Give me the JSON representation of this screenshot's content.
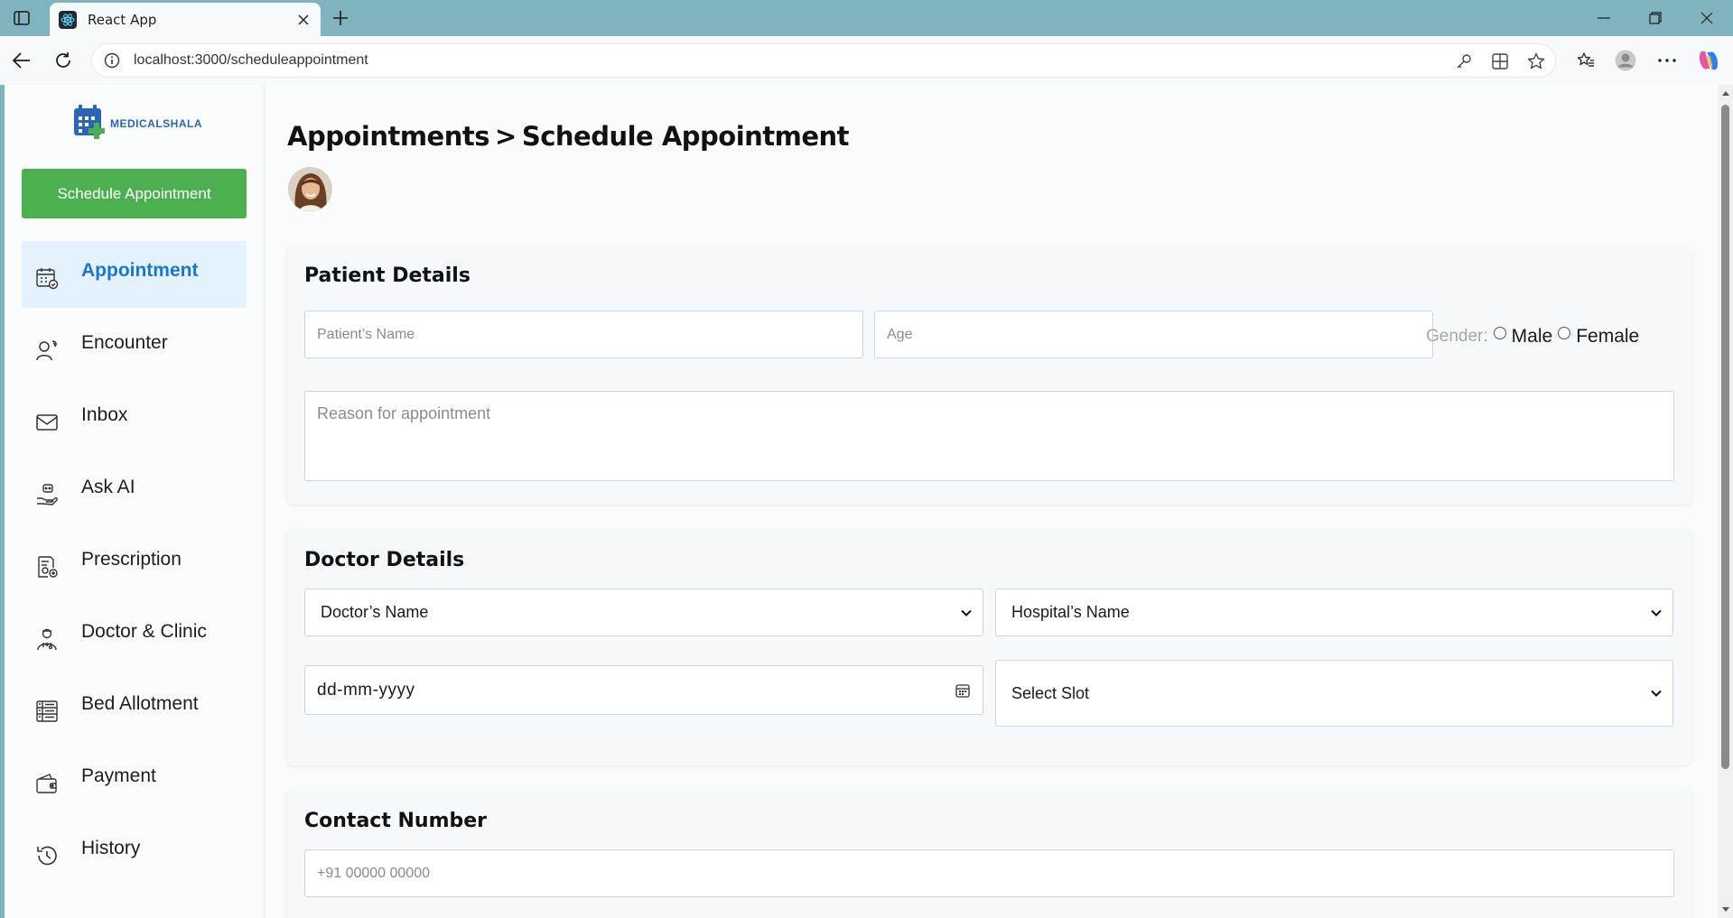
{
  "browser": {
    "tab_title": "React App",
    "url": "localhost:3000/scheduleappointment"
  },
  "sidebar": {
    "logo_text": "MEDICALSHALA",
    "schedule_button": "Schedule Appointment",
    "items": [
      {
        "label": "Appointment",
        "icon": "calendar-icon",
        "active": true
      },
      {
        "label": "Encounter",
        "icon": "user-chat-icon",
        "active": false
      },
      {
        "label": "Inbox",
        "icon": "mail-icon",
        "active": false
      },
      {
        "label": "Ask AI",
        "icon": "hand-ai-icon",
        "active": false
      },
      {
        "label": "Prescription",
        "icon": "prescription-icon",
        "active": false
      },
      {
        "label": "Doctor & Clinic",
        "icon": "doctor-icon",
        "active": false
      },
      {
        "label": "Bed Allotment",
        "icon": "bed-list-icon",
        "active": false
      },
      {
        "label": "Payment",
        "icon": "wallet-icon",
        "active": false
      },
      {
        "label": "History",
        "icon": "history-icon",
        "active": false
      }
    ]
  },
  "page": {
    "breadcrumb_parent": "Appointments",
    "breadcrumb_sep": ">",
    "breadcrumb_current": "Schedule Appointment"
  },
  "patient": {
    "title": "Patient Details",
    "name_placeholder": "Patient’s Name",
    "age_placeholder": "Age",
    "gender_label": "Gender:",
    "gender_options": [
      "Male",
      "Female"
    ],
    "reason_placeholder": "Reason for appointment"
  },
  "doctor": {
    "title": "Doctor Details",
    "doctor_select": "Doctor’s Name",
    "hospital_select": "Hospital’s Name",
    "date_placeholder": "dd-mm-yyyy",
    "slot_select": "Select Slot"
  },
  "contact": {
    "title": "Contact Number",
    "phone_placeholder": "+91 00000 00000"
  },
  "colors": {
    "accent_green": "#4caf50",
    "active_blue": "#1976d2",
    "active_bg": "#e3f2fd",
    "browser_frame": "#7fb4bf"
  }
}
